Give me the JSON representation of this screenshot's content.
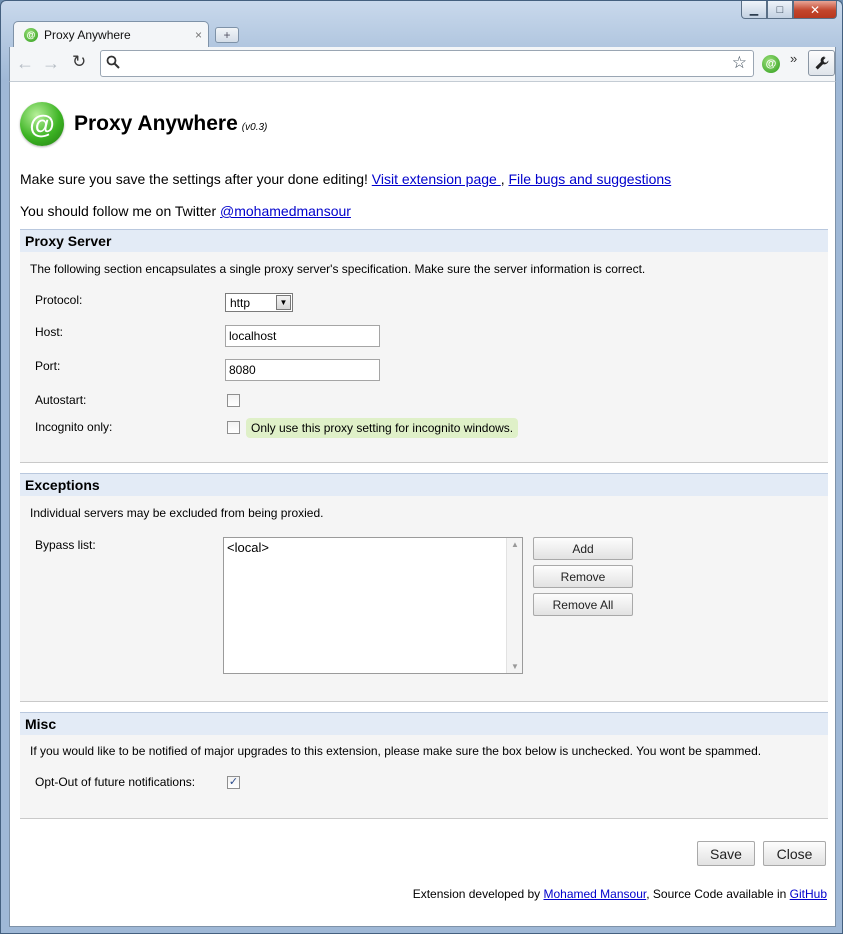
{
  "browser": {
    "tab_title": "Proxy Anywhere",
    "tab_close": "×",
    "new_tab_icon": "new-tab-icon",
    "address_value": "",
    "window_controls": {
      "minimize": "▁",
      "maximize": "□",
      "close": "✕"
    }
  },
  "header": {
    "title": "Proxy Anywhere",
    "version": "(v0.3)",
    "logo_glyph": "@"
  },
  "notice": {
    "text": "Make sure you save the settings after your done editing!",
    "link1": "Visit extension page ",
    "separator": ", ",
    "link2": "File bugs and suggestions "
  },
  "follow": {
    "text": "You should follow me on Twitter ",
    "handle": "@mohamedmansour"
  },
  "proxy_server": {
    "heading": "Proxy Server",
    "description": "The following section encapsulates a single proxy server's specification. Make sure the server information is correct.",
    "protocol_label": "Protocol:",
    "protocol_value": "http",
    "host_label": "Host:",
    "host_value": "localhost",
    "port_label": "Port:",
    "port_value": "8080",
    "autostart_label": "Autostart:",
    "autostart_checked": false,
    "incognito_label": "Incognito only:",
    "incognito_checked": false,
    "incognito_hint": "Only use this proxy setting for incognito windows."
  },
  "exceptions": {
    "heading": "Exceptions",
    "description": "Individual servers may be excluded from being proxied.",
    "bypass_label": "Bypass list:",
    "bypass_items": [
      "<local>"
    ],
    "add_label": "Add",
    "remove_label": "Remove",
    "remove_all_label": "Remove All"
  },
  "misc": {
    "heading": "Misc",
    "description": "If you would like to be notified of major upgrades to this extension, please make sure the box below is unchecked. You wont be spammed.",
    "optout_label": "Opt-Out of future notifications:",
    "optout_checked": true,
    "check_glyph": "✓"
  },
  "actions": {
    "save_label": "Save",
    "close_label": "Close"
  },
  "footer": {
    "prefix": "Extension developed by ",
    "author": "Mohamed Mansour",
    "middle": ", Source Code available in ",
    "repo": "GitHub"
  },
  "colors": {
    "section_header_bg": "#e3ebf6",
    "link": "#0000cc",
    "hint_bg": "#dff0c8",
    "logo_green": "#3db424"
  }
}
